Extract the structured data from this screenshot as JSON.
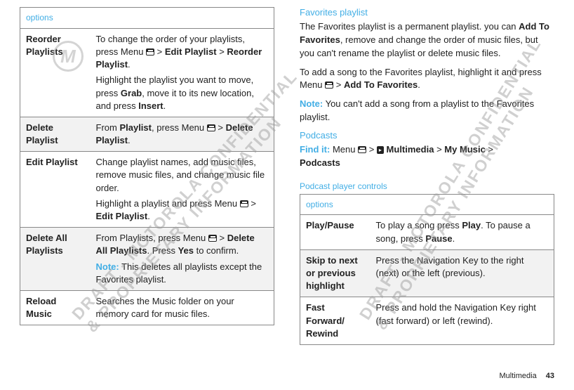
{
  "left": {
    "options_label": "options",
    "rows": [
      {
        "name": "Reorder Playlists",
        "desc_pre": "To change the order of your playlists, press Menu ",
        "desc_mid": " > ",
        "bold1": "Edit Playlist",
        "sep1": " > ",
        "bold2": "Reorder Playlist",
        "end1": ".",
        "p2_pre": "Highlight the playlist you want to move, press ",
        "p2_b1": "Grab",
        "p2_mid": ", move it to its new location, and press ",
        "p2_b2": "Insert",
        "p2_end": "."
      },
      {
        "name": "Delete Playlist",
        "desc_pre": "From ",
        "b0": "Playlist",
        "desc_mid": ", press Menu ",
        "sep1": " > ",
        "bold1": "Delete Playlist",
        "end1": "."
      },
      {
        "name": "Edit Playlist",
        "p1": "Change playlist names, add music files, remove music files, and change music file order.",
        "p2_pre": "Highlight a playlist and press Menu ",
        "sep": " > ",
        "p2_b": "Edit Playlist",
        "p2_end": "."
      },
      {
        "name": "Delete All Playlists",
        "desc_pre": "From Playlists, press Menu ",
        "sep1": " > ",
        "bold1": "Delete All Playlists",
        "mid": ". Press ",
        "bold2": "Yes",
        "end": " to confirm.",
        "note_label": "Note:",
        "note": " This deletes all playlists except the Favorites playlist."
      },
      {
        "name": "Reload Music",
        "desc": "Searches the Music folder on your memory card for music files."
      }
    ]
  },
  "right": {
    "h1": "Favorites playlist",
    "p1_pre": "The Favorites playlist is a permanent playlist. you can ",
    "p1_b": "Add To Favorites",
    "p1_post": ", remove and change the order of music files, but you can't rename the playlist or delete music files.",
    "p2_pre": "To add a song to the Favorites playlist, highlight it and press Menu ",
    "p2_sep": " > ",
    "p2_b": "Add To Favorites",
    "p2_end": ".",
    "note_label": "Note:",
    "note_text": " You can't add a song from a playlist to the Favorites playlist.",
    "h2": "Podcasts",
    "findit_label": "Find it:",
    "findit_pre": " Menu ",
    "findit_sep1": " > ",
    "findit_mm": "Multimedia",
    "findit_sep2": " > ",
    "findit_b2": "My Music",
    "findit_sep3": " > ",
    "findit_b3": "Podcasts",
    "h3": "Podcast player controls",
    "options_label": "options",
    "rows": [
      {
        "name": "Play/Pause",
        "pre": "To play a song press ",
        "b1": "Play",
        "mid": ". To pause a song, press ",
        "b2": "Pause",
        "end": "."
      },
      {
        "name": "Skip to next or previous highlight",
        "text": "Press the Navigation Key to the right (next) or the left (previous)."
      },
      {
        "name": "Fast Forward/ Rewind",
        "text": "Press and hold the Navigation Key right (fast forward) or left (rewind)."
      }
    ]
  },
  "footer": {
    "label": "Multimedia",
    "page": "43"
  },
  "watermarks": {
    "w1a": "DRAFT - MOTOROLA CONFIDENTIAL",
    "w1b": "& PROPRIETARY INFORMATION",
    "w2a": "DRAFT - MOTOROLA CONFIDENTIAL",
    "w2b": "& PROPRIETARY INFORMATION"
  }
}
